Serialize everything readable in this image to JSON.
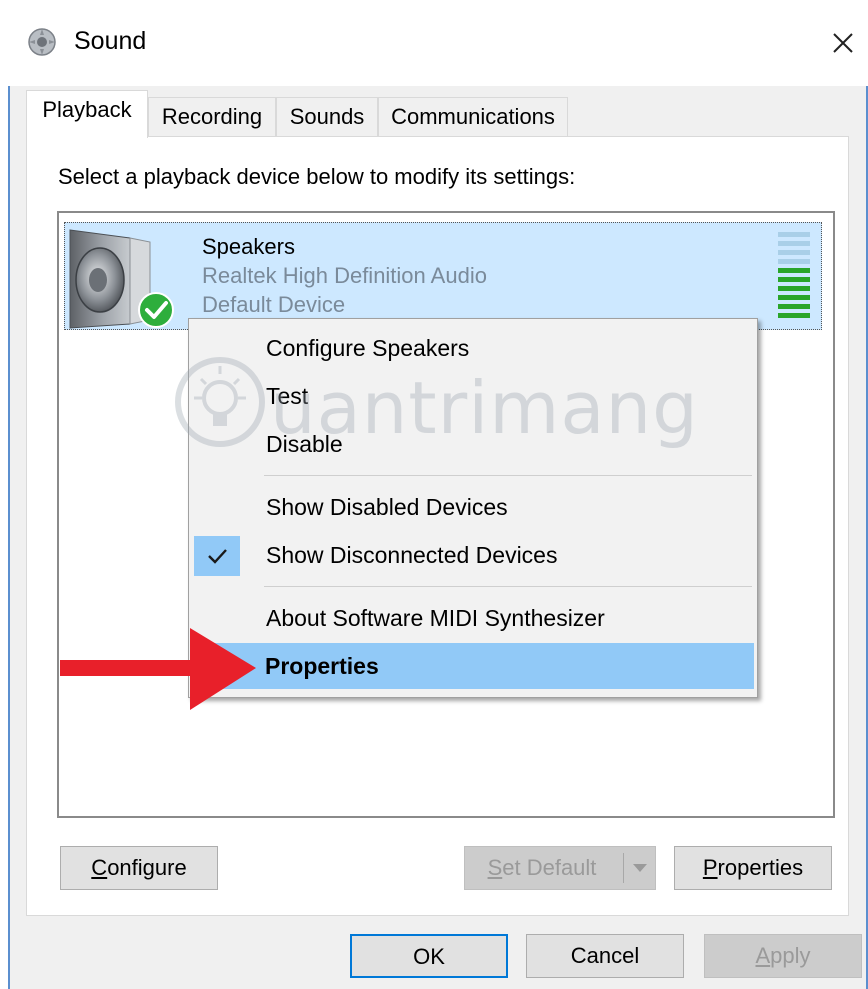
{
  "window": {
    "title": "Sound",
    "close_glyph": "✕"
  },
  "tabs": [
    {
      "label": "Playback",
      "active": true
    },
    {
      "label": "Recording",
      "active": false
    },
    {
      "label": "Sounds",
      "active": false
    },
    {
      "label": "Communications",
      "active": false
    }
  ],
  "playback": {
    "instruction": "Select a playback device below to modify its settings:",
    "devices": [
      {
        "name": "Speakers",
        "driver": "Realtek High Definition Audio",
        "status": "Default Device",
        "icon": "speaker-icon",
        "status_icon": "green-check-icon",
        "level_fraction": 0.6
      }
    ]
  },
  "context_menu": {
    "groups": [
      [
        {
          "label": "Configure Speakers",
          "checked": false,
          "highlighted": false
        },
        {
          "label": "Test",
          "checked": false,
          "highlighted": false
        },
        {
          "label": "Disable",
          "checked": false,
          "highlighted": false
        }
      ],
      [
        {
          "label": "Show Disabled Devices",
          "checked": false,
          "highlighted": false
        },
        {
          "label": "Show Disconnected Devices",
          "checked": true,
          "highlighted": false
        }
      ],
      [
        {
          "label": "About Software MIDI Synthesizer",
          "checked": false,
          "highlighted": false
        },
        {
          "label": "Properties",
          "checked": false,
          "highlighted": true
        }
      ]
    ]
  },
  "watermark": {
    "text": "uantrimang",
    "icon": "lightbulb-icon"
  },
  "annotation": {
    "icon": "red-arrow-icon",
    "color": "#e8202a"
  },
  "buttons": {
    "configure": {
      "mnemonic": "C",
      "rest": "onfigure"
    },
    "set_default": {
      "mnemonic": "S",
      "rest": "et Default",
      "disabled": true
    },
    "properties": {
      "mnemonic": "P",
      "rest": "roperties"
    },
    "ok": "OK",
    "cancel": "Cancel",
    "apply": {
      "mnemonic": "A",
      "rest": "pply",
      "disabled": true
    }
  },
  "colors": {
    "selection": "#cde8ff",
    "menu_highlight": "#91c9f7",
    "level_on": "#2aa52a",
    "level_off": "#a9cfe8",
    "default_button_border": "#0078d7"
  }
}
